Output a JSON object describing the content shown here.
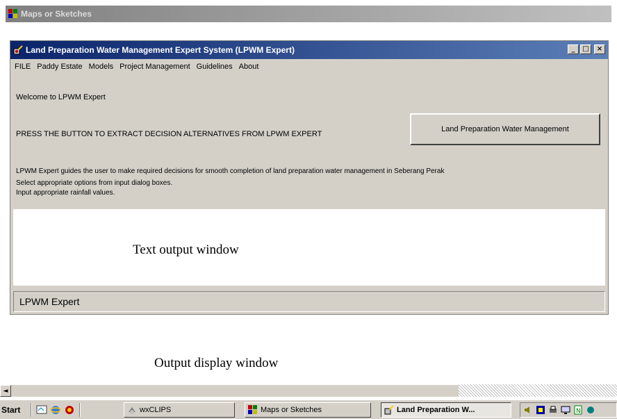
{
  "outer_window": {
    "title": "Maps or Sketches"
  },
  "inner_window": {
    "title": "Land Preparation Water Management Expert System (LPWM Expert)",
    "minimize_glyph": "_",
    "maximize_glyph": "□",
    "close_glyph": "×"
  },
  "menu": {
    "items": [
      "FILE",
      "Paddy Estate",
      "Models",
      "Project Management",
      "Guidelines",
      "About"
    ]
  },
  "content": {
    "welcome": "Welcome to LPWM Expert",
    "press_instruction": "PRESS THE BUTTON TO EXTRACT DECISION ALTERNATIVES FROM LPWM EXPERT",
    "main_button": "Land Preparation Water Management",
    "description": "LPWM Expert guides the user to make required decisions for smooth completion of land preparation water management in Seberang Perak",
    "instruction_1": "Select appropriate options from input dialog boxes.",
    "instruction_2": "Input appropriate rainfall values.",
    "text_output_label": "Text output window",
    "status_text": "LPWM Expert"
  },
  "output_display": {
    "label": "Output display window",
    "scroll_left_glyph": "◄"
  },
  "taskbar": {
    "start_label": "Start",
    "tasks": [
      {
        "label": "wxCLIPS",
        "active": false
      },
      {
        "label": "Maps or Sketches",
        "active": false
      },
      {
        "label": "Land Preparation W...",
        "active": true
      }
    ]
  },
  "colors": {
    "inner_title_start": "#0a246a",
    "inner_title_end": "#5c7fb8",
    "window_face": "#d4d0c8"
  }
}
